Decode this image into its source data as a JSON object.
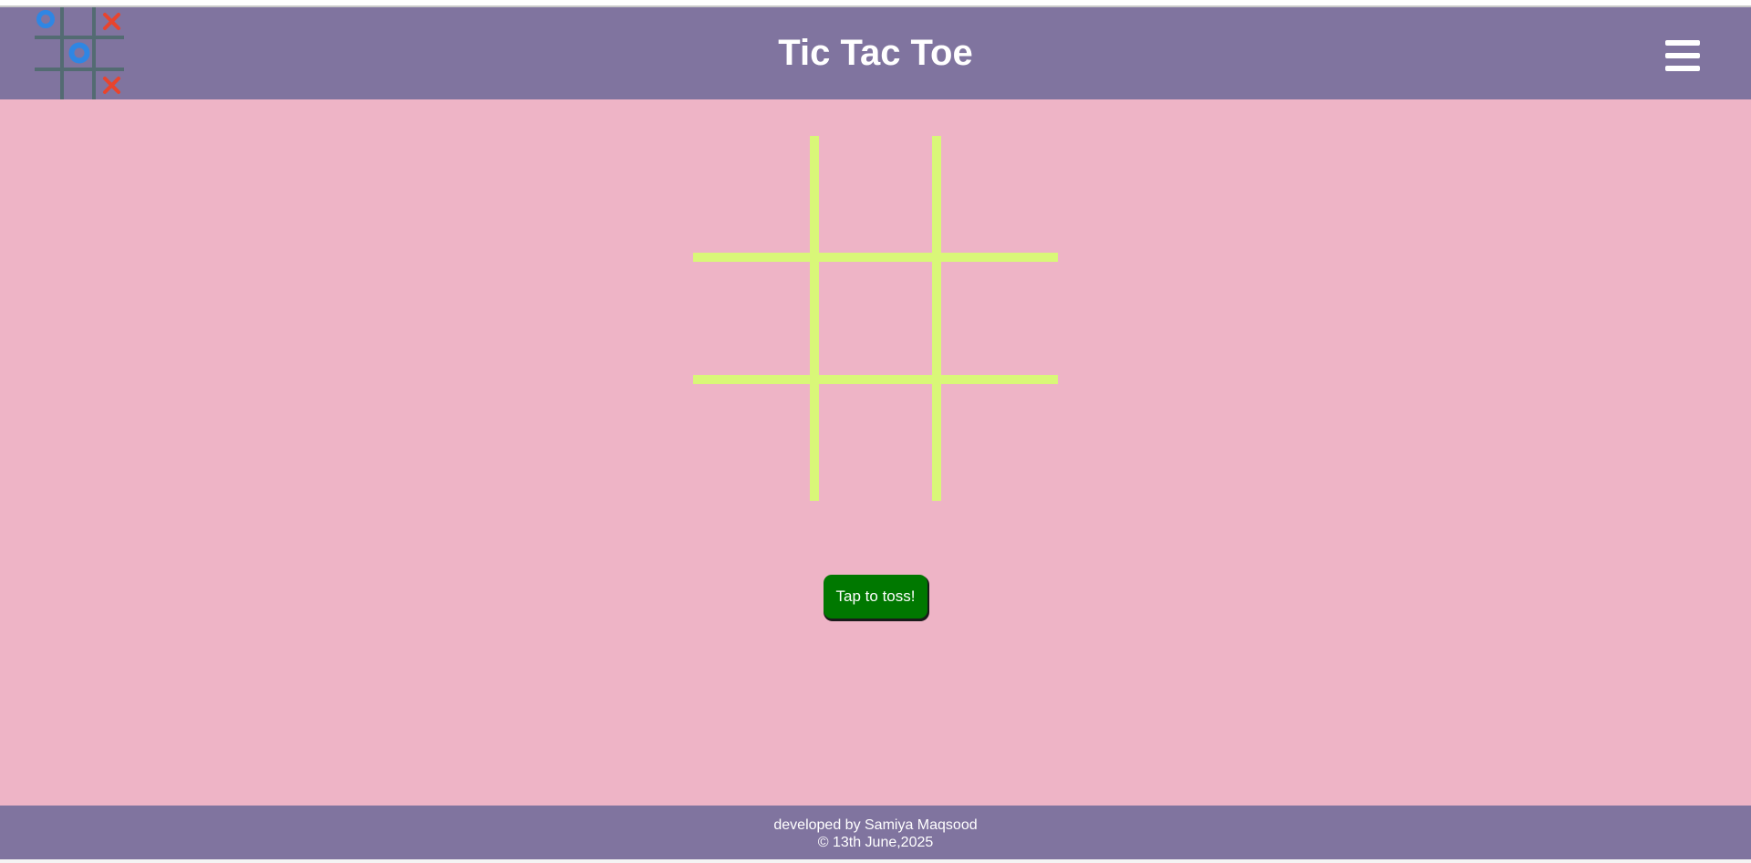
{
  "header": {
    "title": "Tic Tac Toe",
    "logo": {
      "icon": "tic-tac-toe-logo-icon",
      "grid_color": "#4c6a6b",
      "o_color": "#2f86e3",
      "x_color": "#e8442d"
    },
    "menu_icon": "hamburger-menu-icon"
  },
  "board": {
    "line_color": "#d9f778",
    "cells": [
      "",
      "",
      "",
      "",
      "",
      "",
      "",
      "",
      ""
    ]
  },
  "toss_button": {
    "label": "Tap to toss!",
    "color": "#007800"
  },
  "footer": {
    "line1": "developed by Samiya Maqsood",
    "line2": "© 13th June,2025"
  },
  "colors": {
    "header_bg": "#80749f",
    "main_bg": "#eeb4c6",
    "text": "#ffffff"
  }
}
